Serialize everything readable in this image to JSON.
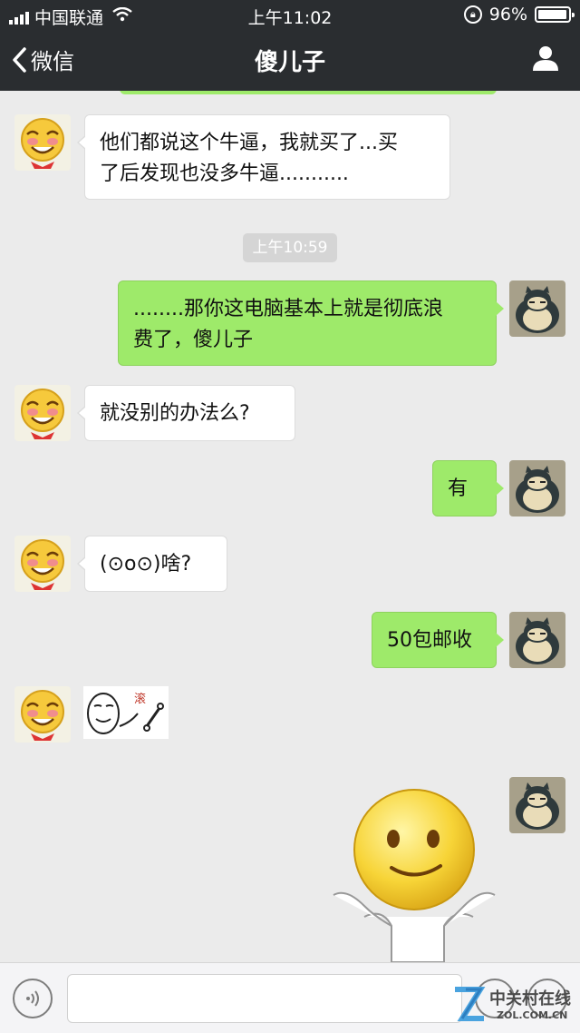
{
  "status_bar": {
    "carrier": "中国联通",
    "time": "上午11:02",
    "battery": "96%",
    "battery_level": 0.96
  },
  "nav": {
    "back_label": "微信",
    "title": "傻儿子"
  },
  "messages": [
    {
      "side": "in",
      "text_line1": "他们都说这个牛逼，我就买了...买",
      "text_line2": "了后发现也没多牛逼..........."
    },
    {
      "side": "out",
      "text_line1": "........那你这电脑基本上就是彻底浪",
      "text_line2": "费了，傻儿子"
    },
    {
      "side": "in",
      "text": "就没别的办法么?"
    },
    {
      "side": "out",
      "text": "有"
    },
    {
      "side": "in",
      "text": "(⊙o⊙)啥?"
    },
    {
      "side": "out",
      "text": "50包邮收"
    }
  ],
  "timestamp": "上午10:59",
  "sticker_small_text": "滚",
  "watermark": {
    "line1": "中关村在线",
    "line2": "ZOL.COM.CN"
  },
  "colors": {
    "header_bg": "#2a2d30",
    "chat_bg": "#ebebeb",
    "out_bubble": "#9eea6a",
    "in_bubble": "#ffffff"
  }
}
